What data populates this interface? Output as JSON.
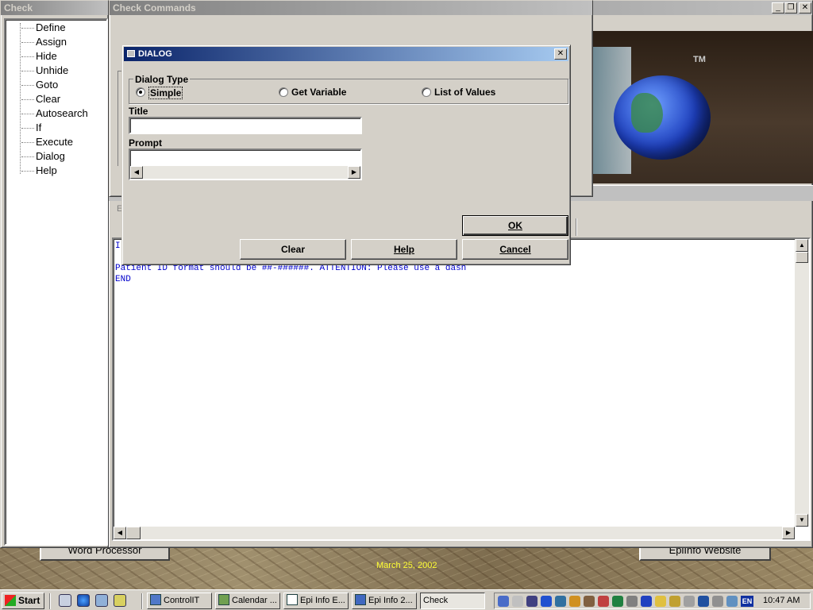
{
  "desktop": {
    "date": "March 25, 2002",
    "left_button": "Word Processor",
    "right_button": "EpiInfo Website"
  },
  "check_window": {
    "title": "Check",
    "items": [
      "Define",
      "Assign",
      "Hide",
      "Unhide",
      "Goto",
      "Clear",
      "Autosearch",
      "If",
      "Execute",
      "Dialog",
      "Help"
    ]
  },
  "main_window": {
    "logo_tm": "TM",
    "editor_lines": [
      "I",
      "",
      "Patient ID format should be ##-######.  ATTENTION: Please use a dash",
      "END"
    ],
    "status_letter": "E"
  },
  "check_commands": {
    "title": "Check Commands"
  },
  "dialog": {
    "title": "DIALOG",
    "dialog_type_label": "Dialog Type",
    "options": [
      "Simple",
      "Get Variable",
      "List of Values"
    ],
    "selected_option": "Simple",
    "title_label": "Title",
    "title_value": "",
    "prompt_label": "Prompt",
    "prompt_value": "",
    "ok": "OK",
    "clear": "Clear",
    "help": "Help",
    "cancel": "Cancel"
  },
  "taskbar": {
    "start": "Start",
    "tasks": [
      "ControlIT",
      "Calendar ...",
      "Epi Info E...",
      "Epi Info 2...",
      "Check"
    ],
    "tray_lang": "EN",
    "clock": "10:47 AM"
  },
  "colors": {
    "active_title": "#0a246a",
    "inactive_title": "#808080",
    "editor_text": "#0000cc",
    "date_text": "#ffff33"
  }
}
